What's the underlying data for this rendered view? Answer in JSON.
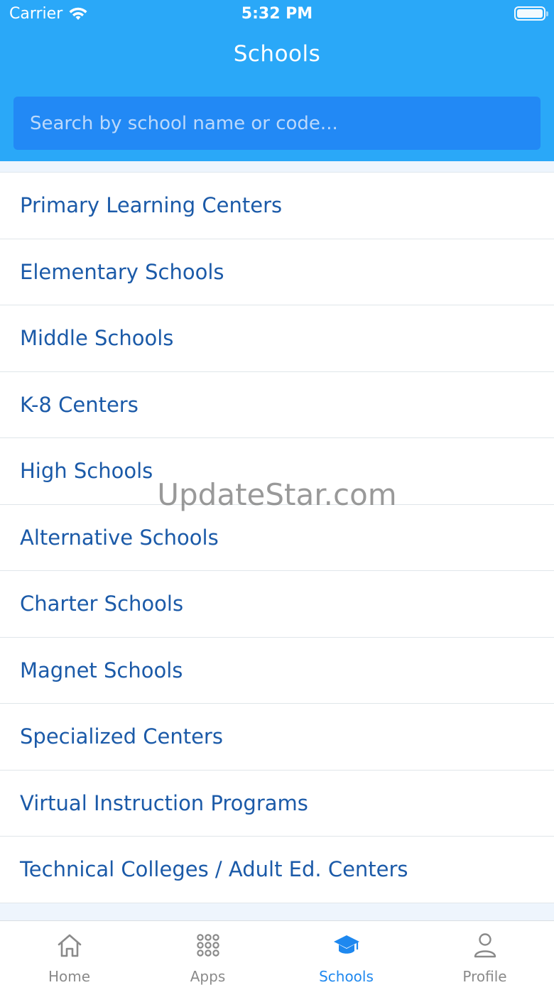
{
  "status_bar": {
    "carrier": "Carrier",
    "time": "5:32 PM"
  },
  "header": {
    "title": "Schools",
    "search_placeholder": "Search by school name or code..."
  },
  "school_types": [
    "Primary Learning Centers",
    "Elementary Schools",
    "Middle Schools",
    "K-8 Centers",
    "High Schools",
    "Alternative Schools",
    "Charter Schools",
    "Magnet Schools",
    "Specialized Centers",
    "Virtual Instruction Programs",
    "Technical Colleges / Adult Ed. Centers"
  ],
  "watermark": "UpdateStar.com",
  "tabs": [
    {
      "label": "Home",
      "icon": "home-icon",
      "active": false
    },
    {
      "label": "Apps",
      "icon": "grid-icon",
      "active": false
    },
    {
      "label": "Schools",
      "icon": "graduation-cap-icon",
      "active": true
    },
    {
      "label": "Profile",
      "icon": "person-icon",
      "active": false
    }
  ],
  "colors": {
    "header_bg": "#2aa8f8",
    "search_bg": "#2289f5",
    "list_text": "#1b5aa8",
    "tab_active": "#1e88ef",
    "tab_inactive": "#8a8a8a"
  }
}
